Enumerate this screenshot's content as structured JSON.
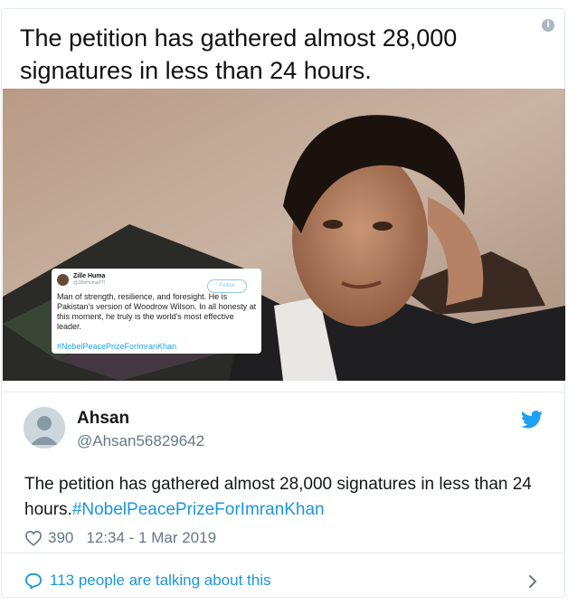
{
  "headline": "The petition has gathered almost 28,000 signatures in less than 24 hours.",
  "embedded_tweet": {
    "name": "Zille Huma",
    "handle": "@ZilleHumaPTI",
    "follow_label": "Follow",
    "text": "Man of strength, resilience, and foresight. He is Pakistan's version of Woodrow Wilson. In all honesty at this moment, he truly is the world's most effective leader.",
    "hashtag": "#NobelPeacePrizeForImranKhan"
  },
  "tweet": {
    "author_name": "Ahsan",
    "author_handle": "@Ahsan56829642",
    "text": "The petition has gathered almost 28,000 signatures in less than 24 hours.",
    "hashtag": "#NobelPeacePrizeForImranKhan",
    "likes": "390",
    "timestamp": "12:34 - 1 Mar 2019"
  },
  "footer": {
    "talking_label": "113 people are talking about this"
  },
  "icons": {
    "info": "info-icon",
    "twitter": "twitter-bird-icon",
    "like": "heart-icon",
    "reply": "speech-bubble-icon",
    "chevron": "chevron-right-icon"
  },
  "colors": {
    "link": "#1b95e0",
    "muted": "#657786",
    "twitter_blue": "#1da1f2"
  }
}
